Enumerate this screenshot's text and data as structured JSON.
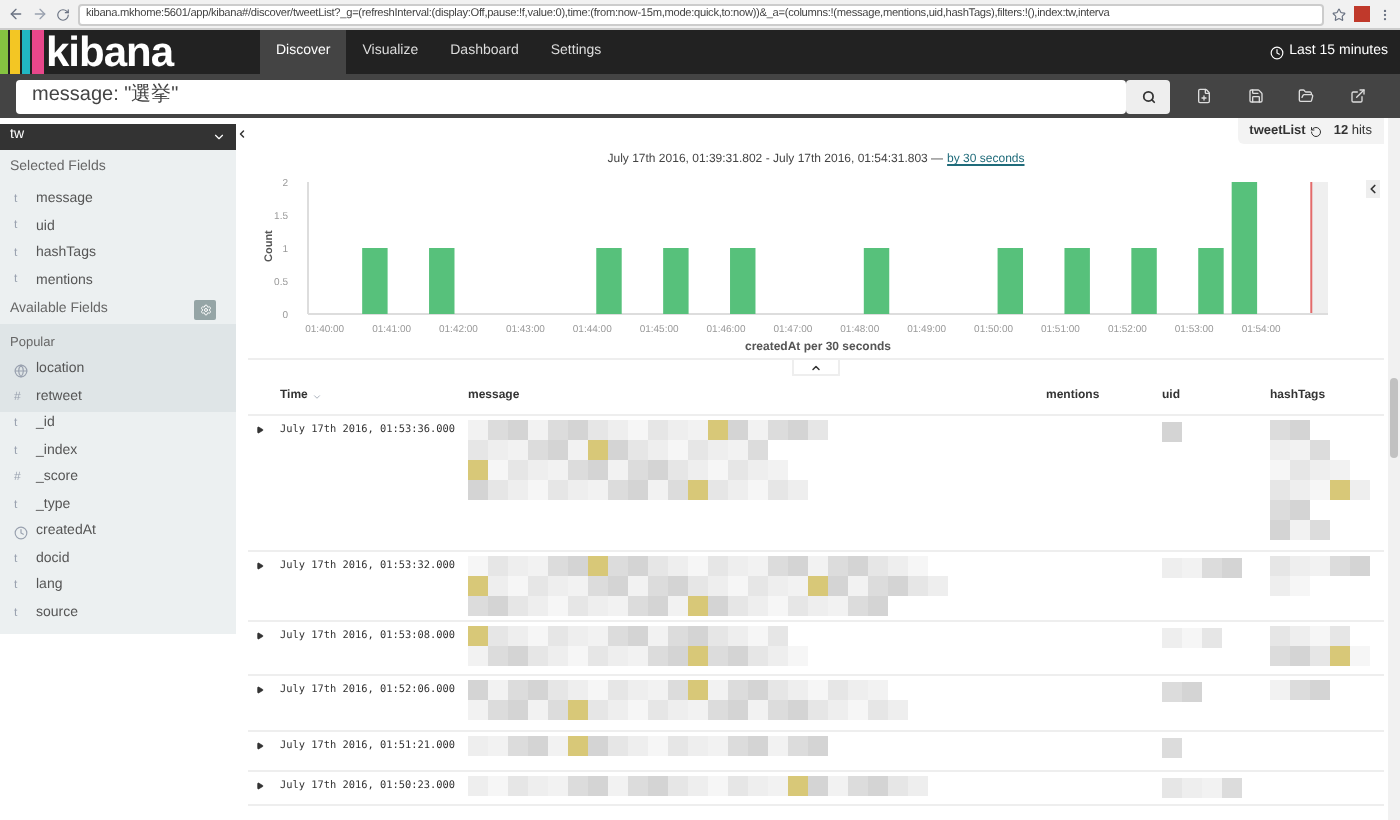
{
  "browser": {
    "url": "kibana.mkhome:5601/app/kibana#/discover/tweetList?_g=(refreshInterval:(display:Off,pause:!f,value:0),time:(from:now-15m,mode:quick,to:now))&_a=(columns:!(message,mentions,uid,hashTags),filters:!(),index:tw,interva"
  },
  "nav": {
    "logo": "kibana",
    "tabs": [
      {
        "label": "Discover",
        "selected": true
      },
      {
        "label": "Visualize",
        "selected": false
      },
      {
        "label": "Dashboard",
        "selected": false
      },
      {
        "label": "Settings",
        "selected": false
      }
    ],
    "time_range": "Last 15 minutes"
  },
  "search": {
    "value": "message: \"選挙\""
  },
  "sidebar": {
    "index": "tw",
    "selected_title": "Selected Fields",
    "selected_fields": [
      {
        "name": "message",
        "kind": "text",
        "glyph": "t"
      },
      {
        "name": "uid",
        "kind": "text",
        "glyph": "t"
      },
      {
        "name": "hashTags",
        "kind": "text",
        "glyph": "t"
      },
      {
        "name": "mentions",
        "kind": "text",
        "glyph": "t"
      }
    ],
    "available_title": "Available Fields",
    "popular_title": "Popular",
    "popular_fields": [
      {
        "name": "location",
        "kind": "geo"
      },
      {
        "name": "retweet",
        "kind": "text",
        "glyph": "#"
      }
    ],
    "other_fields": [
      {
        "name": "_id",
        "kind": "text",
        "glyph": "t"
      },
      {
        "name": "_index",
        "kind": "text",
        "glyph": "t"
      },
      {
        "name": "_score",
        "kind": "text",
        "glyph": "#"
      },
      {
        "name": "_type",
        "kind": "text",
        "glyph": "t"
      },
      {
        "name": "createdAt",
        "kind": "date"
      },
      {
        "name": "docid",
        "kind": "text",
        "glyph": "t"
      },
      {
        "name": "lang",
        "kind": "text",
        "glyph": "t"
      },
      {
        "name": "source",
        "kind": "text",
        "glyph": "t"
      }
    ]
  },
  "header": {
    "saved_search": "tweetList",
    "hits_count": "12",
    "hits_label": "hits"
  },
  "range": {
    "text": "July 17th 2016, 01:39:31.802 - July 17th 2016, 01:54:31.803 —",
    "interval_link": "by 30 seconds"
  },
  "chart": {
    "chart_data": {
      "type": "bar",
      "xlabel": "createdAt per 30 seconds",
      "ylabel": "Count",
      "categories": [
        "01:40:00",
        null,
        "01:41:00",
        null,
        "01:42:00",
        null,
        "01:43:00",
        null,
        "01:44:00",
        null,
        "01:45:00",
        null,
        "01:46:00",
        null,
        "01:47:00",
        null,
        "01:48:00",
        null,
        "01:49:00",
        null,
        "01:50:00",
        null,
        "01:51:00",
        null,
        "01:52:00",
        null,
        "01:53:00",
        null,
        "01:54:00",
        null
      ],
      "series": [
        {
          "color": "#57c17b",
          "values": [
            0,
            1,
            0,
            1,
            0,
            0,
            0,
            0,
            1,
            0,
            1,
            0,
            1,
            0,
            0,
            0,
            1,
            0,
            0,
            0,
            1,
            0,
            1,
            0,
            1,
            0,
            1,
            2,
            0,
            0
          ]
        }
      ],
      "ylim": [
        0,
        2
      ],
      "yticks": [
        0,
        {
          "value": 0.5,
          "label": "0.5"
        },
        1,
        {
          "value": 1.5,
          "label": "1.5"
        },
        2
      ]
    }
  },
  "table": {
    "columns": [
      {
        "label": "Time",
        "sorted": true
      },
      {
        "label": "message",
        "sorted": false
      },
      {
        "label": "mentions",
        "sorted": false
      },
      {
        "label": "uid",
        "sorted": false
      },
      {
        "label": "hashTags",
        "sorted": false
      }
    ],
    "rows": [
      {
        "time": "July 17th 2016, 01:53:36.000"
      },
      {
        "time": "July 17th 2016, 01:53:32.000"
      },
      {
        "time": "July 17th 2016, 01:53:08.000"
      },
      {
        "time": "July 17th 2016, 01:52:06.000"
      },
      {
        "time": "July 17th 2016, 01:51:21.000"
      },
      {
        "time": "July 17th 2016, 01:50:23.000"
      }
    ]
  }
}
